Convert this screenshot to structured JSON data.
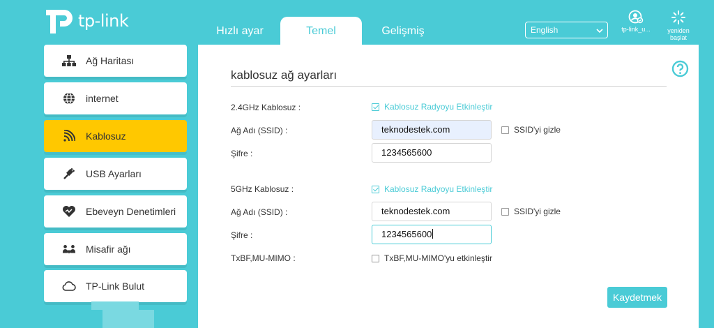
{
  "brand": {
    "name": "tp-link",
    "color": "#4acbd6",
    "accent": "#ffc800"
  },
  "header": {
    "tabs": [
      {
        "label": "Hızlı ayar"
      },
      {
        "label": "Temel"
      },
      {
        "label": "Gelişmiş"
      }
    ],
    "active_tab": "Temel",
    "language": {
      "selected": "English"
    },
    "user_button": {
      "label": "tp-link_u...",
      "icon": "user-icon"
    },
    "reboot_button": {
      "label_line1": "yeniden",
      "label_line2": "başlat",
      "icon": "reboot-icon"
    }
  },
  "sidebar": {
    "items": [
      {
        "label": "Ağ Haritası",
        "icon": "network-map-icon"
      },
      {
        "label": "internet",
        "icon": "globe-icon"
      },
      {
        "label": "Kablosuz",
        "icon": "wireless-icon",
        "active": true
      },
      {
        "label": "USB Ayarları",
        "icon": "usb-icon"
      },
      {
        "label": "Ebeveyn Denetimleri",
        "icon": "parental-heart-icon"
      },
      {
        "label": "Misafir ağı",
        "icon": "guest-network-icon"
      },
      {
        "label": "TP-Link Bulut",
        "icon": "cloud-icon"
      }
    ]
  },
  "main": {
    "title": "kablosuz ağ ayarları",
    "band24": {
      "label": "2.4GHz Kablosuz :",
      "enable_label": "Kablosuz Radyoyu Etkinleştir",
      "enable_checked": true,
      "ssid_label": "Ağ Adı (SSID) :",
      "ssid_value": "teknodestek.com",
      "hide_label": "SSID'yi gizle",
      "hide_checked": false,
      "password_label": "Şifre :",
      "password_value": "1234565600"
    },
    "band5": {
      "label": "5GHz Kablosuz :",
      "enable_label": "Kablosuz Radyoyu Etkinleştir",
      "enable_checked": true,
      "ssid_label": "Ağ Adı (SSID) :",
      "ssid_value": "teknodestek.com",
      "hide_label": "SSID'yi gizle",
      "hide_checked": false,
      "password_label": "Şifre :",
      "password_value": "1234565600"
    },
    "mimo": {
      "label": "TxBF,MU-MIMO :",
      "enable_label": "TxBF,MU-MIMO'yu etkinleştir",
      "enable_checked": false
    },
    "save_label": "Kaydetmek"
  }
}
